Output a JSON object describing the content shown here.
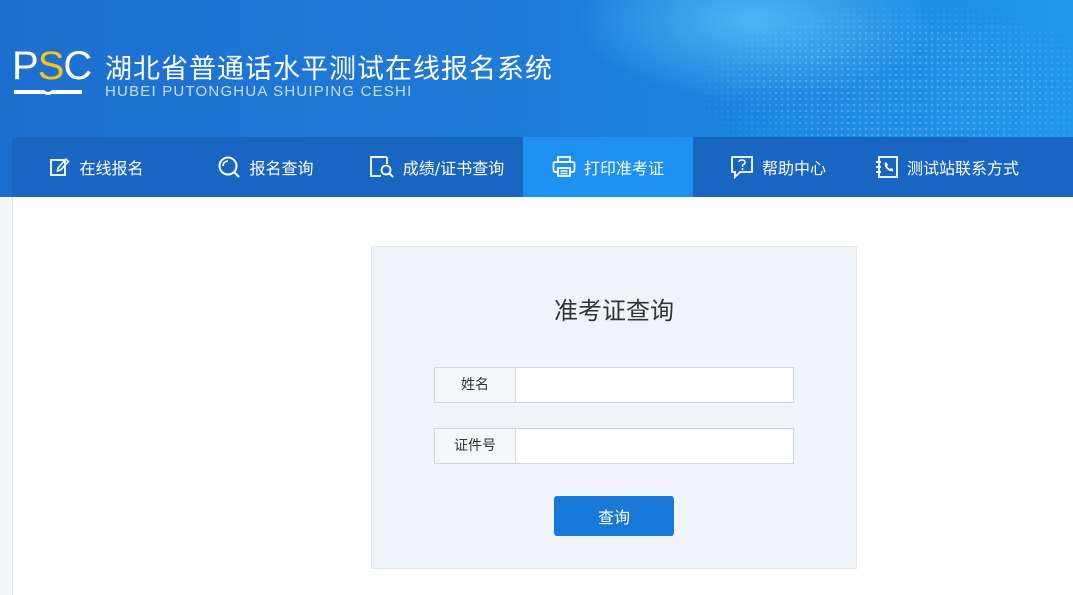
{
  "header": {
    "logo_text": "PSC",
    "title": "湖北省普通话水平测试在线报名系统",
    "subtitle": "HUBEI PUTONGHUA SHUIPING CESHI"
  },
  "nav": {
    "items": [
      {
        "label": "在线报名",
        "icon": "edit-icon",
        "active": false
      },
      {
        "label": "报名查询",
        "icon": "search-circle-icon",
        "active": false
      },
      {
        "label": "成绩/证书查询",
        "icon": "document-search-icon",
        "active": false
      },
      {
        "label": "打印准考证",
        "icon": "printer-icon",
        "active": true
      },
      {
        "label": "帮助中心",
        "icon": "help-chat-icon",
        "active": false
      },
      {
        "label": "测试站联系方式",
        "icon": "phone-book-icon",
        "active": false
      }
    ]
  },
  "form": {
    "title": "准考证查询",
    "name_label": "姓名",
    "name_value": "",
    "id_label": "证件号",
    "id_value": "",
    "submit_label": "查询"
  },
  "colors": {
    "header_blue": "#1f7ad8",
    "nav_bg": "#1966c2",
    "nav_active": "#1e90f0",
    "logo_accent": "#f5c518",
    "button_bg": "#1878d8"
  }
}
